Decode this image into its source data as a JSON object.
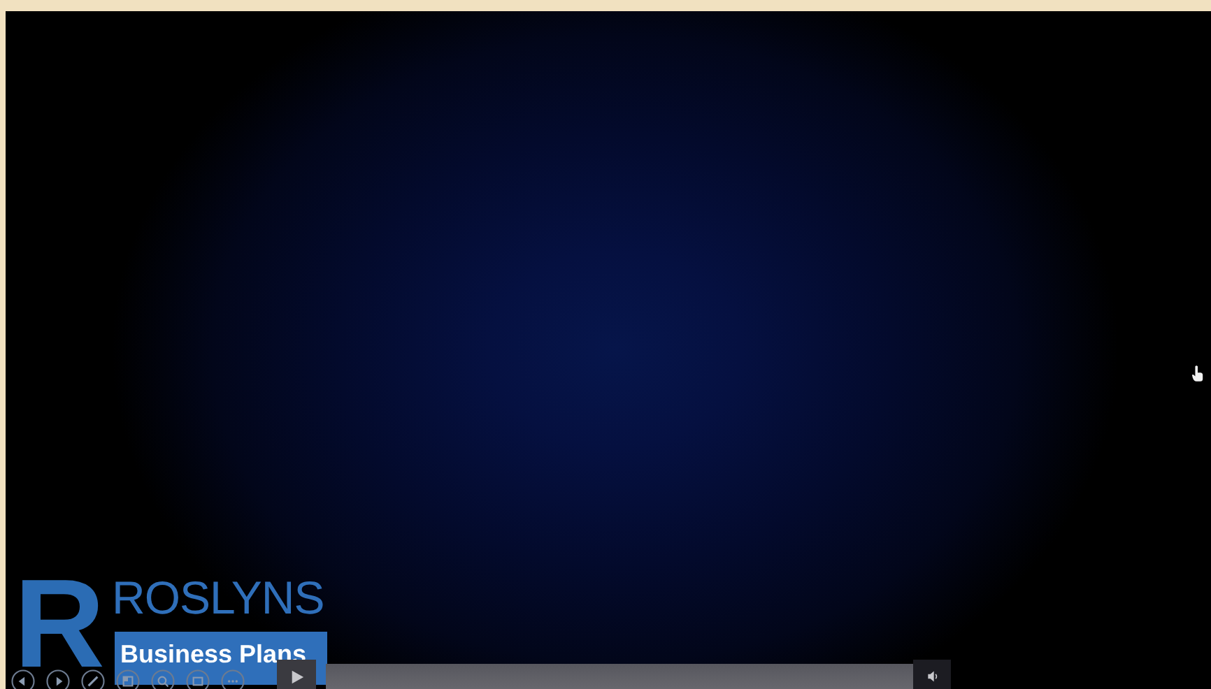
{
  "slide": {
    "logo": {
      "letter": "R",
      "name": "ROSLYNS",
      "tagline": "Business Plans"
    }
  },
  "slideshow_toolbar": [
    {
      "kind": "previous"
    },
    {
      "kind": "next"
    },
    {
      "kind": "pen"
    },
    {
      "kind": "slides"
    },
    {
      "kind": "zoom"
    },
    {
      "kind": "subtitles"
    },
    {
      "kind": "more"
    }
  ],
  "player": {
    "playing": false
  }
}
